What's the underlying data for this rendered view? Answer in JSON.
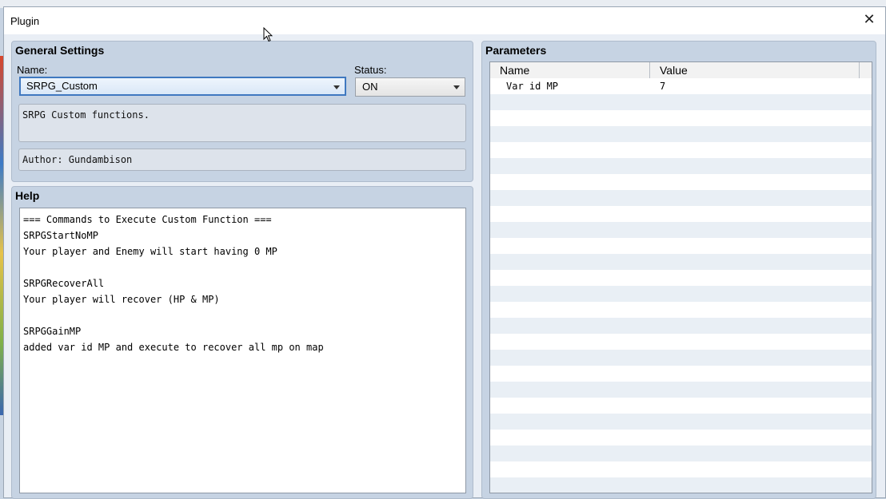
{
  "window": {
    "title": "Plugin",
    "close_glyph": "✕"
  },
  "general": {
    "heading": "General Settings",
    "name_label": "Name:",
    "name_value": "SRPG_Custom",
    "status_label": "Status:",
    "status_value": "ON",
    "description": "SRPG Custom functions.",
    "author": "Author: Gundambison"
  },
  "help": {
    "heading": "Help",
    "lines": [
      "=== Commands to Execute Custom Function ===",
      "SRPGStartNoMP",
      "Your player and Enemy will start having 0 MP",
      "",
      "SRPGRecoverAll",
      "Your player will recover (HP & MP)",
      "",
      "SRPGGainMP",
      "added var id MP and execute to recover all mp on map"
    ]
  },
  "parameters": {
    "heading": "Parameters",
    "columns": [
      "Name",
      "Value"
    ],
    "rows": [
      {
        "name": "Var id MP",
        "value": "7"
      }
    ]
  },
  "icons": {
    "close": "close-icon",
    "dropdown": "chevron-down-icon",
    "cursor": "mouse-cursor-icon"
  }
}
